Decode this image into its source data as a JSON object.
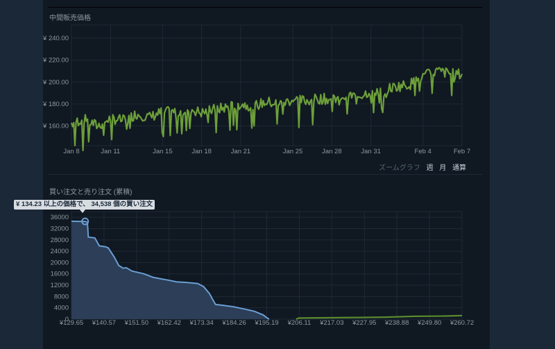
{
  "colors": {
    "page_bg": "#1b2838",
    "panel_bg": "#101822",
    "price_line": "#6d9f3a",
    "buy_line": "#6a9ed3",
    "buy_fill": "#2c3e58",
    "sell_line": "#5a8a2e",
    "grid": "#1e2a36",
    "axis_text": "#8f98a0"
  },
  "price_section": {
    "title": "中間販売価格"
  },
  "depth_section": {
    "title": "買い注文と売り注文 (累積)"
  },
  "zoom": {
    "label": "ズームグラフ",
    "options": [
      "週",
      "月",
      "通算"
    ]
  },
  "tooltip": {
    "text": "¥ 134.23 以上の価格で、 34,538 個の買い注文"
  },
  "chart_data": [
    {
      "type": "line",
      "title": "中間販売価格",
      "x_tick_labels": [
        "Jan 8",
        "Jan 11",
        "Jan 15",
        "Jan 18",
        "Jan 21",
        "Jan 25",
        "Jan 28",
        "Jan 31",
        "Feb 4",
        "Feb 7"
      ],
      "y_tick_labels": [
        "¥ 160.00",
        "¥ 180.00",
        "¥ 200.00",
        "¥ 220.00",
        "¥ 240.00"
      ],
      "y_ticks": [
        160,
        180,
        200,
        220,
        240
      ],
      "xlim": [
        "Jan 8",
        "Feb 7"
      ],
      "ylim": [
        142,
        252
      ],
      "grid": true,
      "series": [
        {
          "points": [
            [
              "Jan 8",
              163
            ],
            [
              "Jan 9",
              166
            ],
            [
              "Jan 10",
              160
            ],
            [
              "Jan 11",
              167
            ],
            [
              "Jan 12",
              165
            ],
            [
              "Jan 13",
              171
            ],
            [
              "Jan 14",
              168
            ],
            [
              "Jan 15",
              173
            ],
            [
              "Jan 16",
              172
            ],
            [
              "Jan 17",
              176
            ],
            [
              "Jan 18",
              172
            ],
            [
              "Jan 19",
              175
            ],
            [
              "Jan 20",
              177
            ],
            [
              "Jan 21",
              180
            ],
            [
              "Jan 22",
              178
            ],
            [
              "Jan 23",
              182
            ],
            [
              "Jan 24",
              180
            ],
            [
              "Jan 25",
              184
            ],
            [
              "Jan 26",
              183
            ],
            [
              "Jan 27",
              185
            ],
            [
              "Jan 28",
              184
            ],
            [
              "Jan 29",
              188
            ],
            [
              "Jan 30",
              187
            ],
            [
              "Jan 31",
              192
            ],
            [
              "Feb 1",
              193
            ],
            [
              "Feb 2",
              196
            ],
            [
              "Feb 3",
              198
            ],
            [
              "Feb 4",
              205
            ],
            [
              "Feb 5",
              210
            ],
            [
              "Feb 6",
              208
            ],
            [
              "Feb 7",
              207
            ]
          ]
        }
      ]
    },
    {
      "type": "area",
      "title": "買い注文と売り注文 (累積)",
      "x_tick_labels": [
        "¥129.65",
        "¥140.57",
        "¥151.50",
        "¥162.42",
        "¥173.34",
        "¥184.26",
        "¥195.19",
        "¥206.11",
        "¥217.03",
        "¥227.95",
        "¥238.88",
        "¥249.80",
        "¥260.72"
      ],
      "y_tick_labels": [
        "0",
        "4000",
        "8000",
        "12000",
        "16000",
        "20000",
        "24000",
        "28000",
        "32000",
        "36000"
      ],
      "y_ticks": [
        0,
        4000,
        8000,
        12000,
        16000,
        20000,
        24000,
        28000,
        32000,
        36000
      ],
      "xlim": [
        129.65,
        260.72
      ],
      "ylim": [
        0,
        38000
      ],
      "grid": true,
      "series": [
        {
          "name": "買い注文",
          "points": [
            [
              129.65,
              34600
            ],
            [
              132.5,
              34538
            ],
            [
              134.23,
              34538
            ],
            [
              135,
              34200
            ],
            [
              135.3,
              29000
            ],
            [
              137.5,
              28700
            ],
            [
              139,
              25900
            ],
            [
              141,
              25600
            ],
            [
              142,
              25200
            ],
            [
              144,
              22000
            ],
            [
              145.5,
              19000
            ],
            [
              147,
              18000
            ],
            [
              148,
              18200
            ],
            [
              150,
              17000
            ],
            [
              152,
              16500
            ],
            [
              154,
              16000
            ],
            [
              157,
              14800
            ],
            [
              160,
              14200
            ],
            [
              162,
              13800
            ],
            [
              165,
              13200
            ],
            [
              168,
              13000
            ],
            [
              172,
              12600
            ],
            [
              174,
              11500
            ],
            [
              176,
              9000
            ],
            [
              177,
              7000
            ],
            [
              178,
              5200
            ],
            [
              181,
              4800
            ],
            [
              184,
              4400
            ],
            [
              188,
              3500
            ],
            [
              191,
              2800
            ],
            [
              194,
              1500
            ],
            [
              195.5,
              300
            ],
            [
              196,
              0
            ]
          ]
        },
        {
          "name": "売り注文",
          "points": [
            [
              205,
              0
            ],
            [
              206,
              400
            ],
            [
              215,
              500
            ],
            [
              225,
              600
            ],
            [
              235,
              700
            ],
            [
              245,
              1000
            ],
            [
              255,
              1100
            ],
            [
              260.72,
              1250
            ]
          ]
        }
      ]
    }
  ]
}
